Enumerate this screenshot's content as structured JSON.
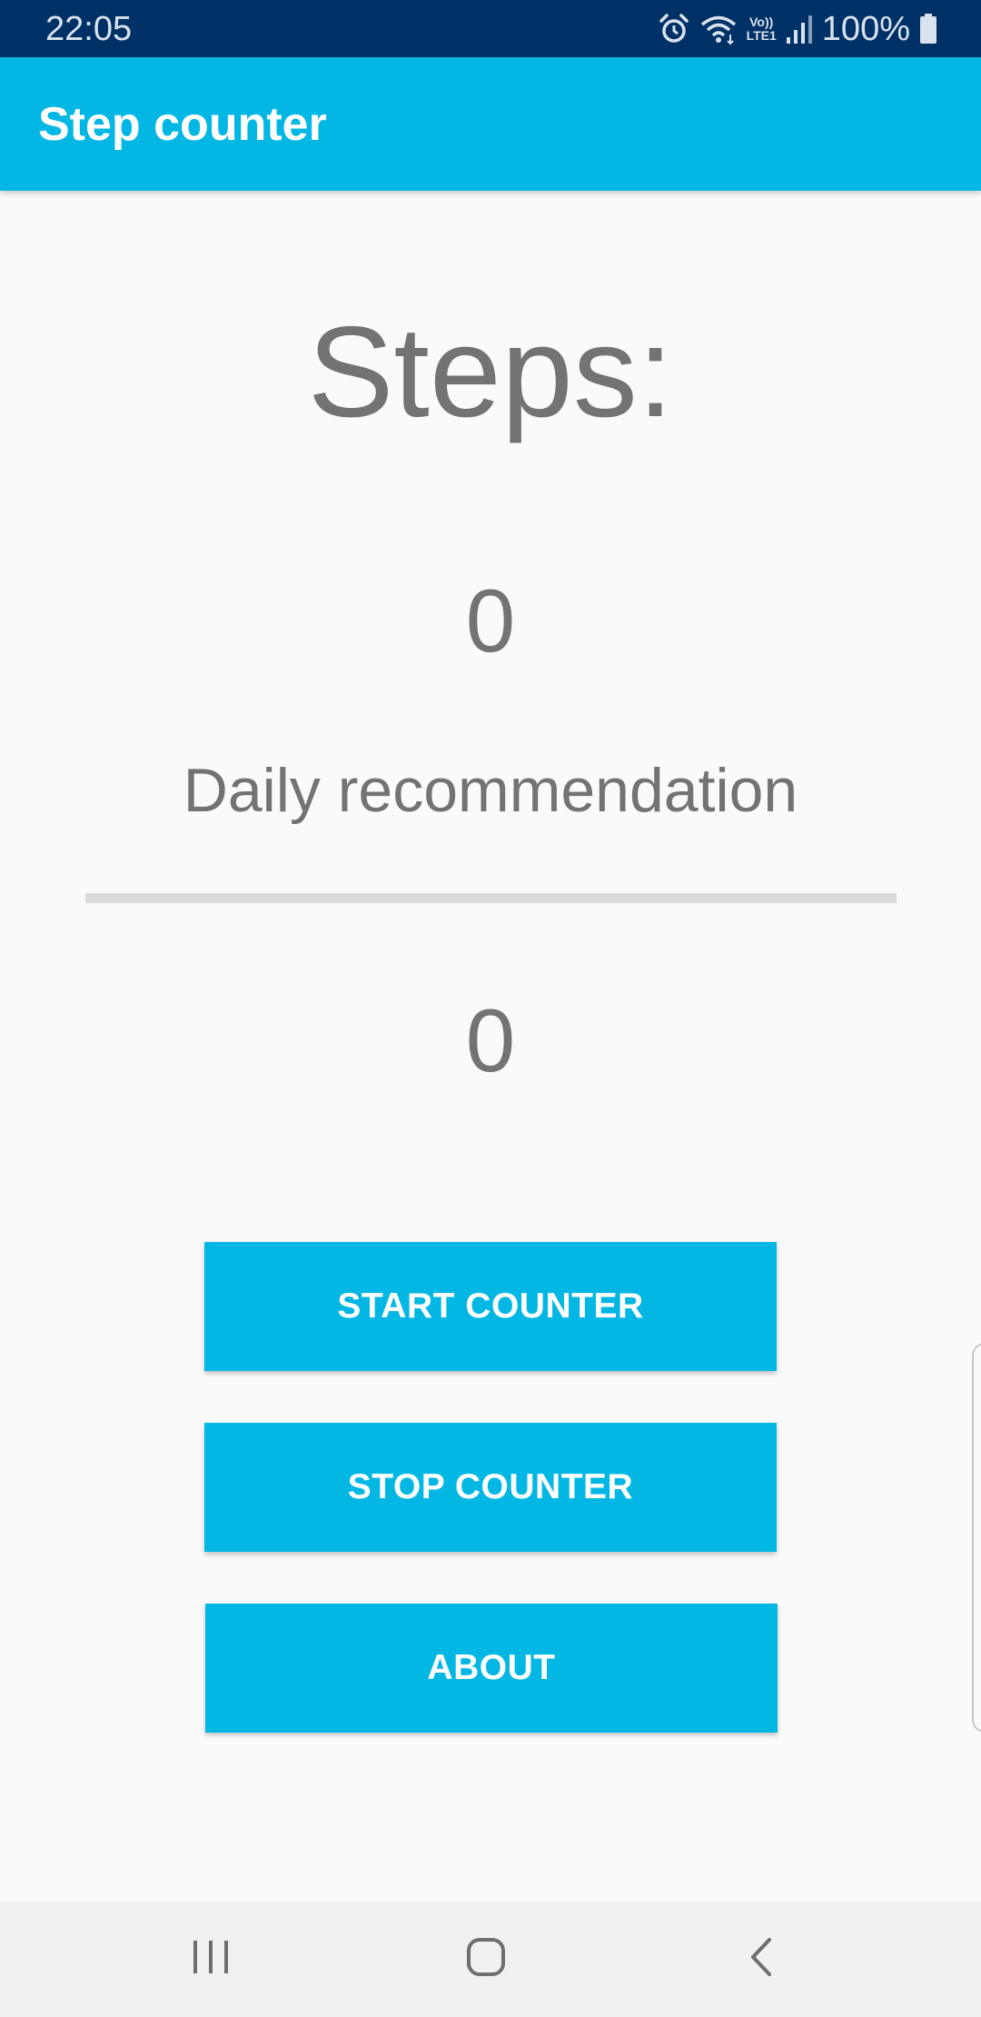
{
  "status_bar": {
    "time": "22:05",
    "battery": "100%",
    "icons": [
      "alarm-icon",
      "wifi-icon",
      "volte-lte-icon",
      "signal-icon",
      "battery-icon"
    ],
    "volte_label": "Vo))",
    "lte_label": "LTE1"
  },
  "app_bar": {
    "title": "Step counter"
  },
  "main": {
    "steps_label": "Steps:",
    "steps_value": "0",
    "daily_label": "Daily recommendation",
    "progress_fraction": 0,
    "recommendation_value": "0"
  },
  "buttons": {
    "start": "START COUNTER",
    "stop": "STOP COUNTER",
    "about": "ABOUT"
  },
  "nav_bar": {
    "icons": [
      "recents-icon",
      "home-icon",
      "back-icon"
    ]
  },
  "colors": {
    "status_bar": "#003166",
    "accent": "#03b7e4",
    "text_gray": "#737373",
    "background": "#fafafa",
    "nav_bar": "#f1f1f1"
  }
}
